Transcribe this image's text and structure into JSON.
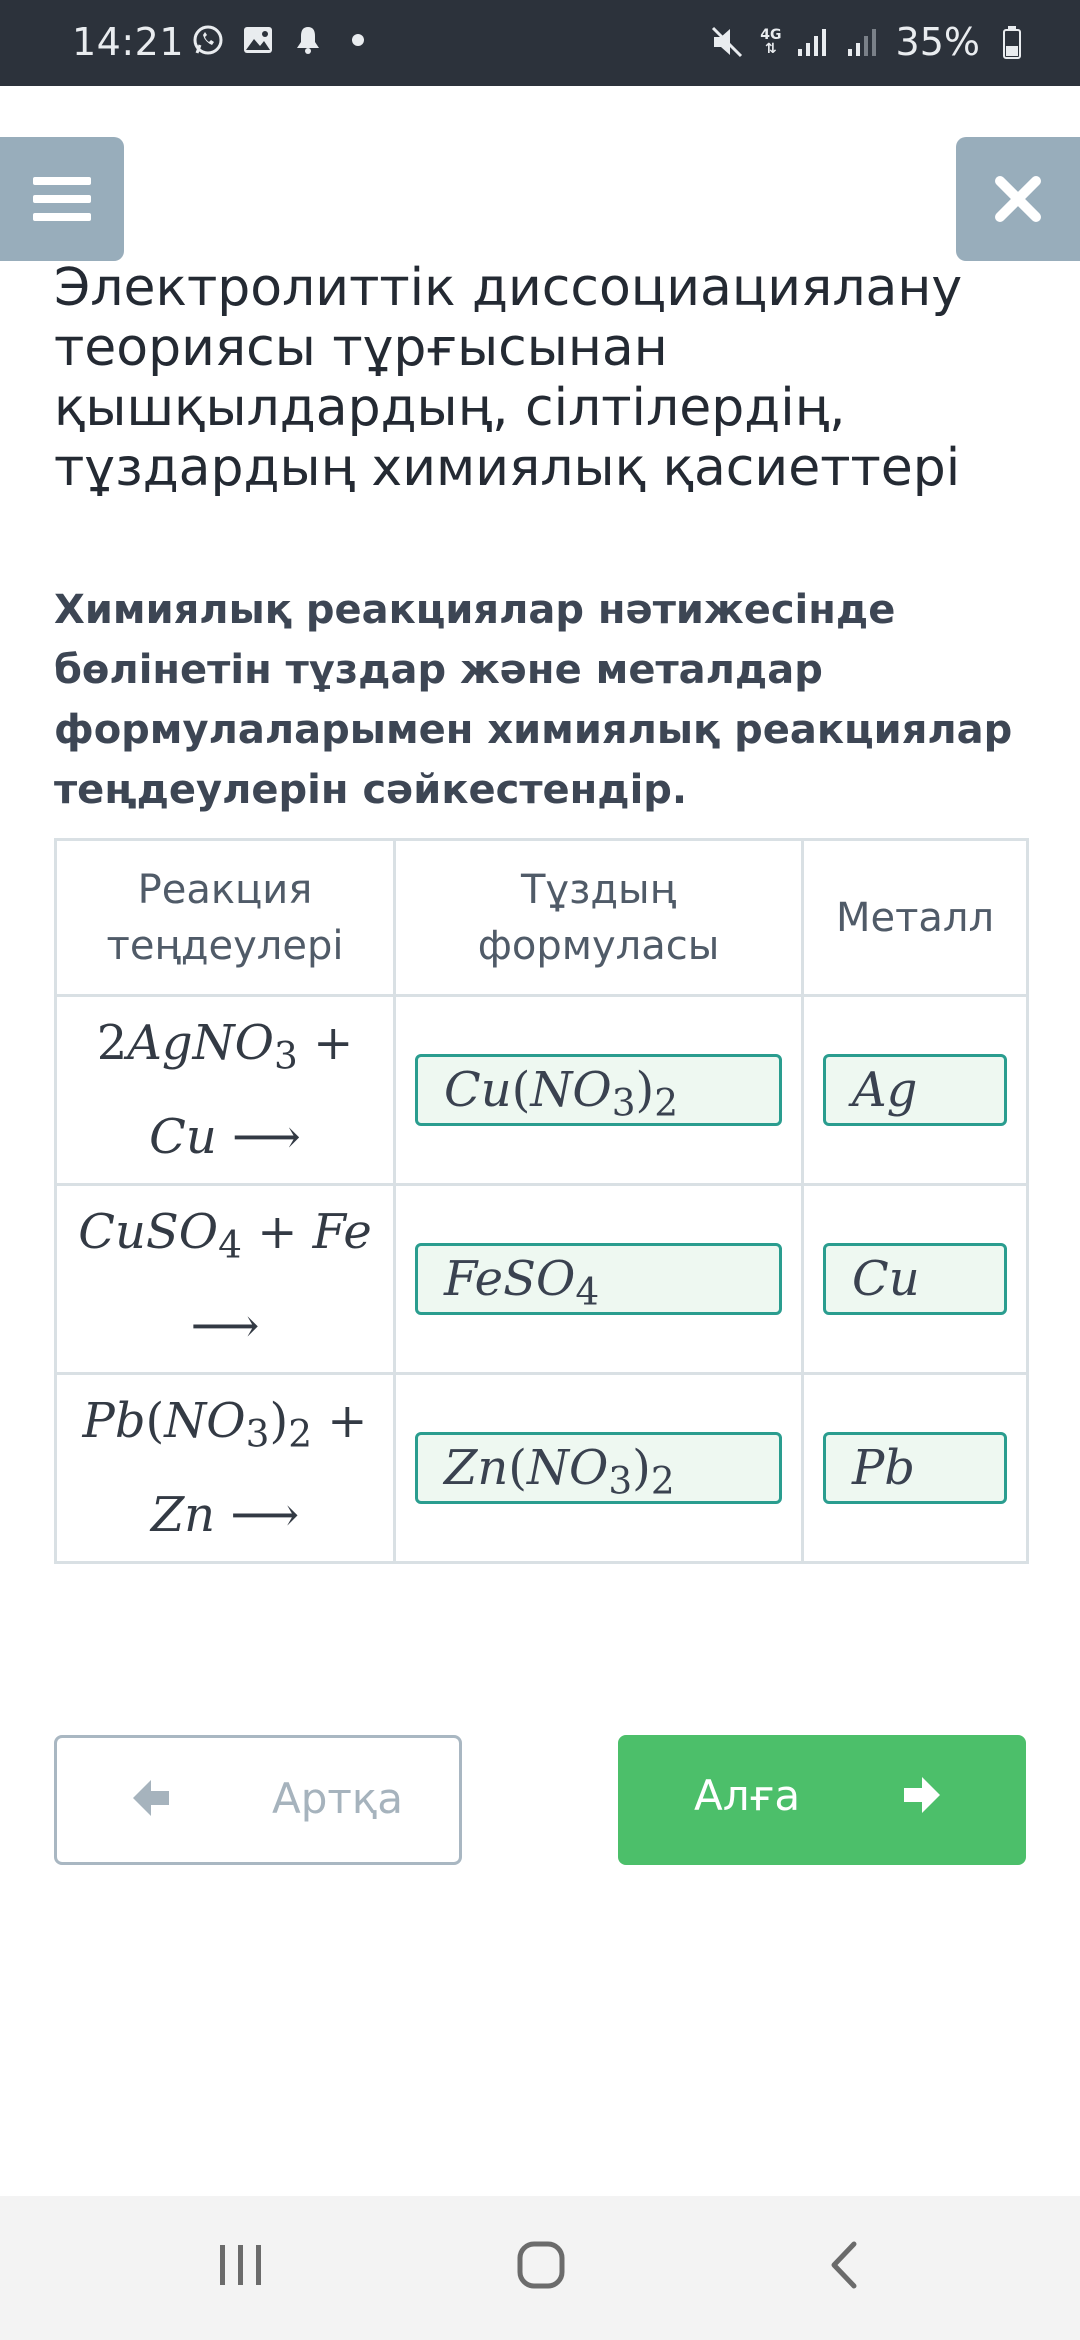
{
  "status_bar": {
    "time": "14:21",
    "network": "4G",
    "battery": "35%"
  },
  "header": {
    "menu_icon": "hamburger-icon",
    "close_icon": "close-icon",
    "title": "Электролиттік диссоциациялану теориясы тұрғысынан қышқылдардың, сілтілердің, тұздардың химиялық қасиеттері"
  },
  "question": "Химиялық реакциялар нәтижесінде бөлінетін тұздар және металдар формулаларымен химиялық реакциялар теңдеулерін сәйкестендір.",
  "table": {
    "headers": [
      "Реакция теңдеулері",
      "Тұздың формуласы",
      "Металл"
    ]
  },
  "navigation": {
    "back_label": "Артқа",
    "next_label": "Алға"
  },
  "colors": {
    "status_bar_bg": "#2c323b",
    "header_button_bg": "#98adbb",
    "chip_border": "#2a9d8f",
    "chip_bg": "#eef8f1",
    "next_button_bg": "#4cbf6a",
    "back_button_border": "#a9b7c2"
  }
}
